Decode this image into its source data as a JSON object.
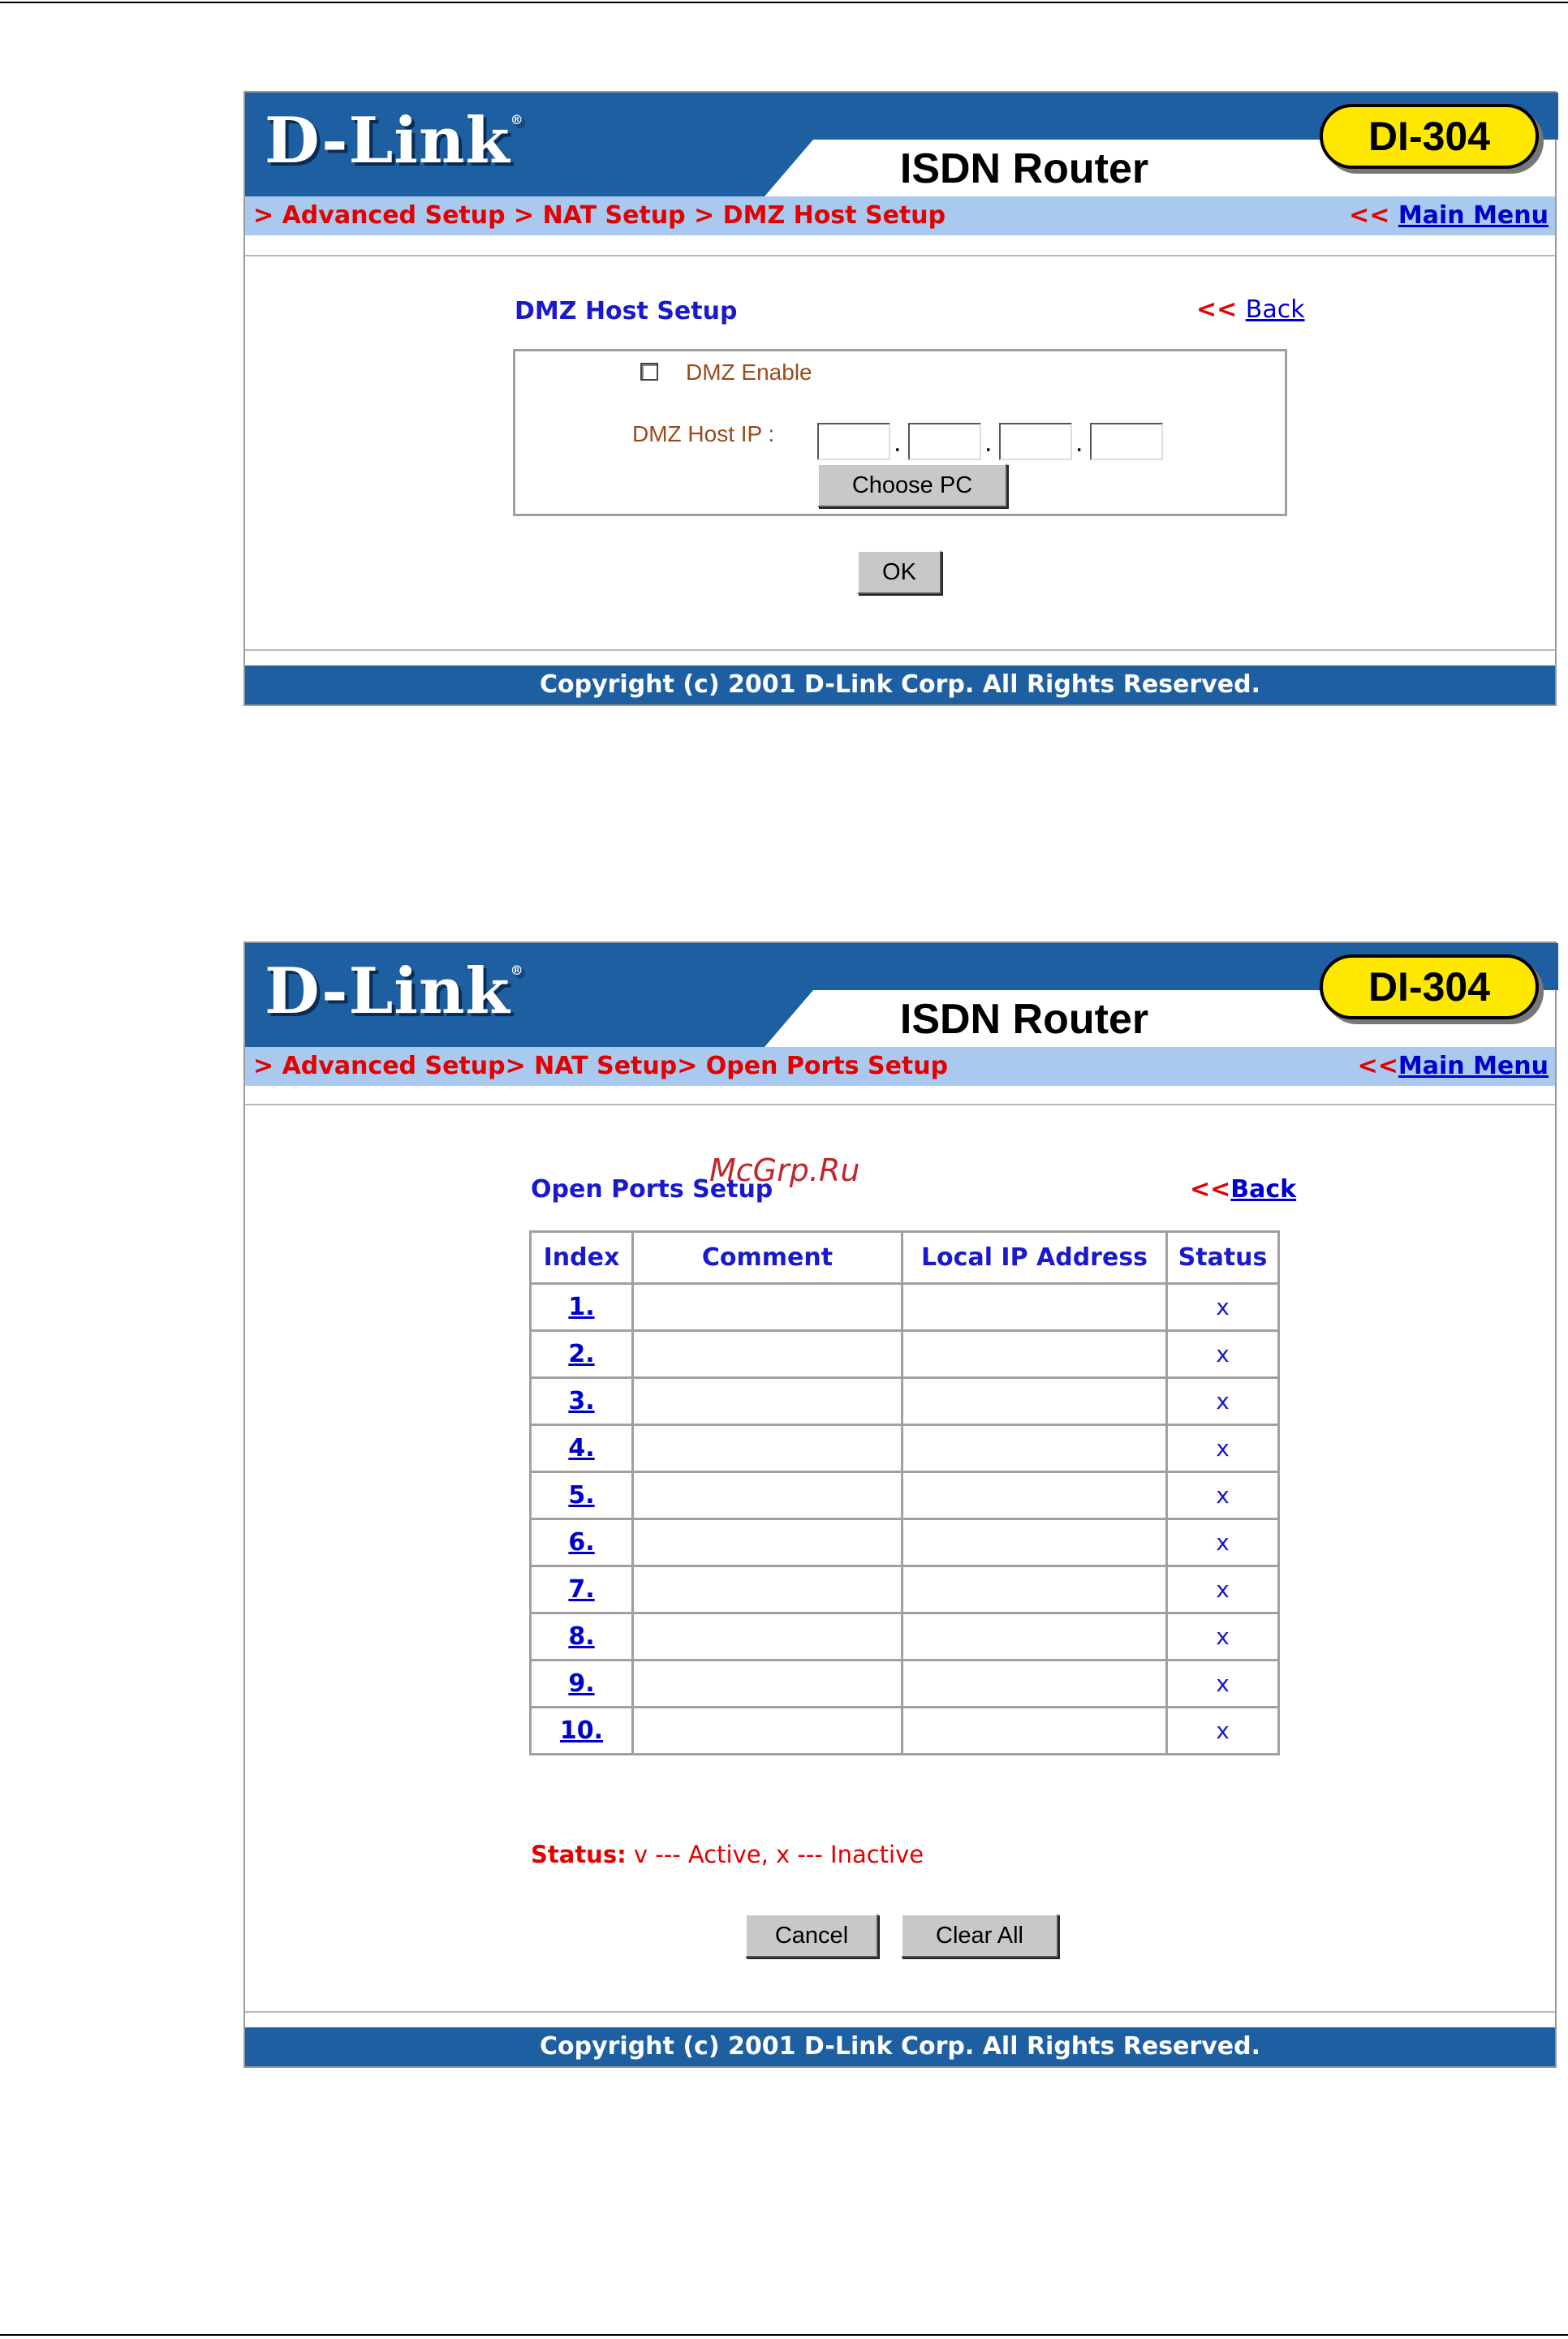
{
  "brand": {
    "logo": "D-Link",
    "logo_reg": "®",
    "product": "ISDN Router",
    "model": "DI-304"
  },
  "copyright": "Copyright (c) 2001 D-Link Corp. All Rights Reserved.",
  "dmz_page": {
    "breadcrumb": "> Advanced Setup > NAT Setup > DMZ Host Setup",
    "main_menu_prefix": "<<",
    "main_menu_label": "Main Menu",
    "title": "DMZ Host Setup",
    "back_prefix": "<<",
    "back_label": "Back",
    "enable_label": "DMZ Enable",
    "enable_checked": false,
    "host_ip_label": "DMZ Host IP :",
    "ip_octets": [
      "",
      "",
      "",
      ""
    ],
    "choose_pc_label": "Choose PC",
    "ok_label": "OK"
  },
  "ports_page": {
    "breadcrumb": "> Advanced Setup> NAT Setup> Open Ports Setup",
    "main_menu_prefix": "<<",
    "main_menu_label": "Main Menu",
    "title": "Open Ports Setup",
    "back_prefix": "<<",
    "back_label": "Back",
    "columns": [
      "Index",
      "Comment",
      "Local IP Address",
      "Status"
    ],
    "rows": [
      {
        "index": "1.",
        "comment": "",
        "ip": "",
        "status": "x"
      },
      {
        "index": "2.",
        "comment": "",
        "ip": "",
        "status": "x"
      },
      {
        "index": "3.",
        "comment": "",
        "ip": "",
        "status": "x"
      },
      {
        "index": "4.",
        "comment": "",
        "ip": "",
        "status": "x"
      },
      {
        "index": "5.",
        "comment": "",
        "ip": "",
        "status": "x"
      },
      {
        "index": "6.",
        "comment": "",
        "ip": "",
        "status": "x"
      },
      {
        "index": "7.",
        "comment": "",
        "ip": "",
        "status": "x"
      },
      {
        "index": "8.",
        "comment": "",
        "ip": "",
        "status": "x"
      },
      {
        "index": "9.",
        "comment": "",
        "ip": "",
        "status": "x"
      },
      {
        "index": "10.",
        "comment": "",
        "ip": "",
        "status": "x"
      }
    ],
    "legend_label": "Status:",
    "legend_text": " v --- Active, x --- Inactive",
    "cancel_label": "Cancel",
    "clear_all_label": "Clear All"
  },
  "watermark": "McGrp.Ru",
  "colors": {
    "brand_blue": "#1d5fa0",
    "nav_blue": "#a9c9ee",
    "accent_red": "#e30000",
    "link_blue": "#0000cc",
    "badge_yellow": "#ffe800"
  }
}
